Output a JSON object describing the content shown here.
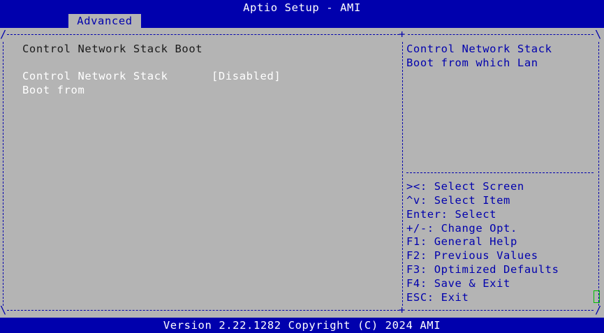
{
  "header": {
    "title": "Aptio Setup - AMI",
    "active_tab": "Advanced"
  },
  "main": {
    "heading": "Control Network Stack Boot",
    "setting": {
      "label_line1": "Control Network Stack",
      "label_line2": "Boot from",
      "value": "[Disabled]"
    }
  },
  "help": {
    "line1": "Control Network Stack",
    "line2": "Boot from which Lan"
  },
  "keys": [
    "><: Select Screen",
    "^v: Select Item",
    "Enter: Select",
    "+/-: Change Opt.",
    "F1: General Help",
    "F2: Previous Values",
    "F3: Optimized Defaults",
    "F4: Save & Exit",
    "ESC: Exit"
  ],
  "footer": {
    "version": "Version 2.22.1282 Copyright (C) 2024 AMI"
  },
  "colors": {
    "background": "#b4b4b4",
    "bar": "#0000ad",
    "frame": "#0000ad",
    "cursor": "#00c000"
  }
}
